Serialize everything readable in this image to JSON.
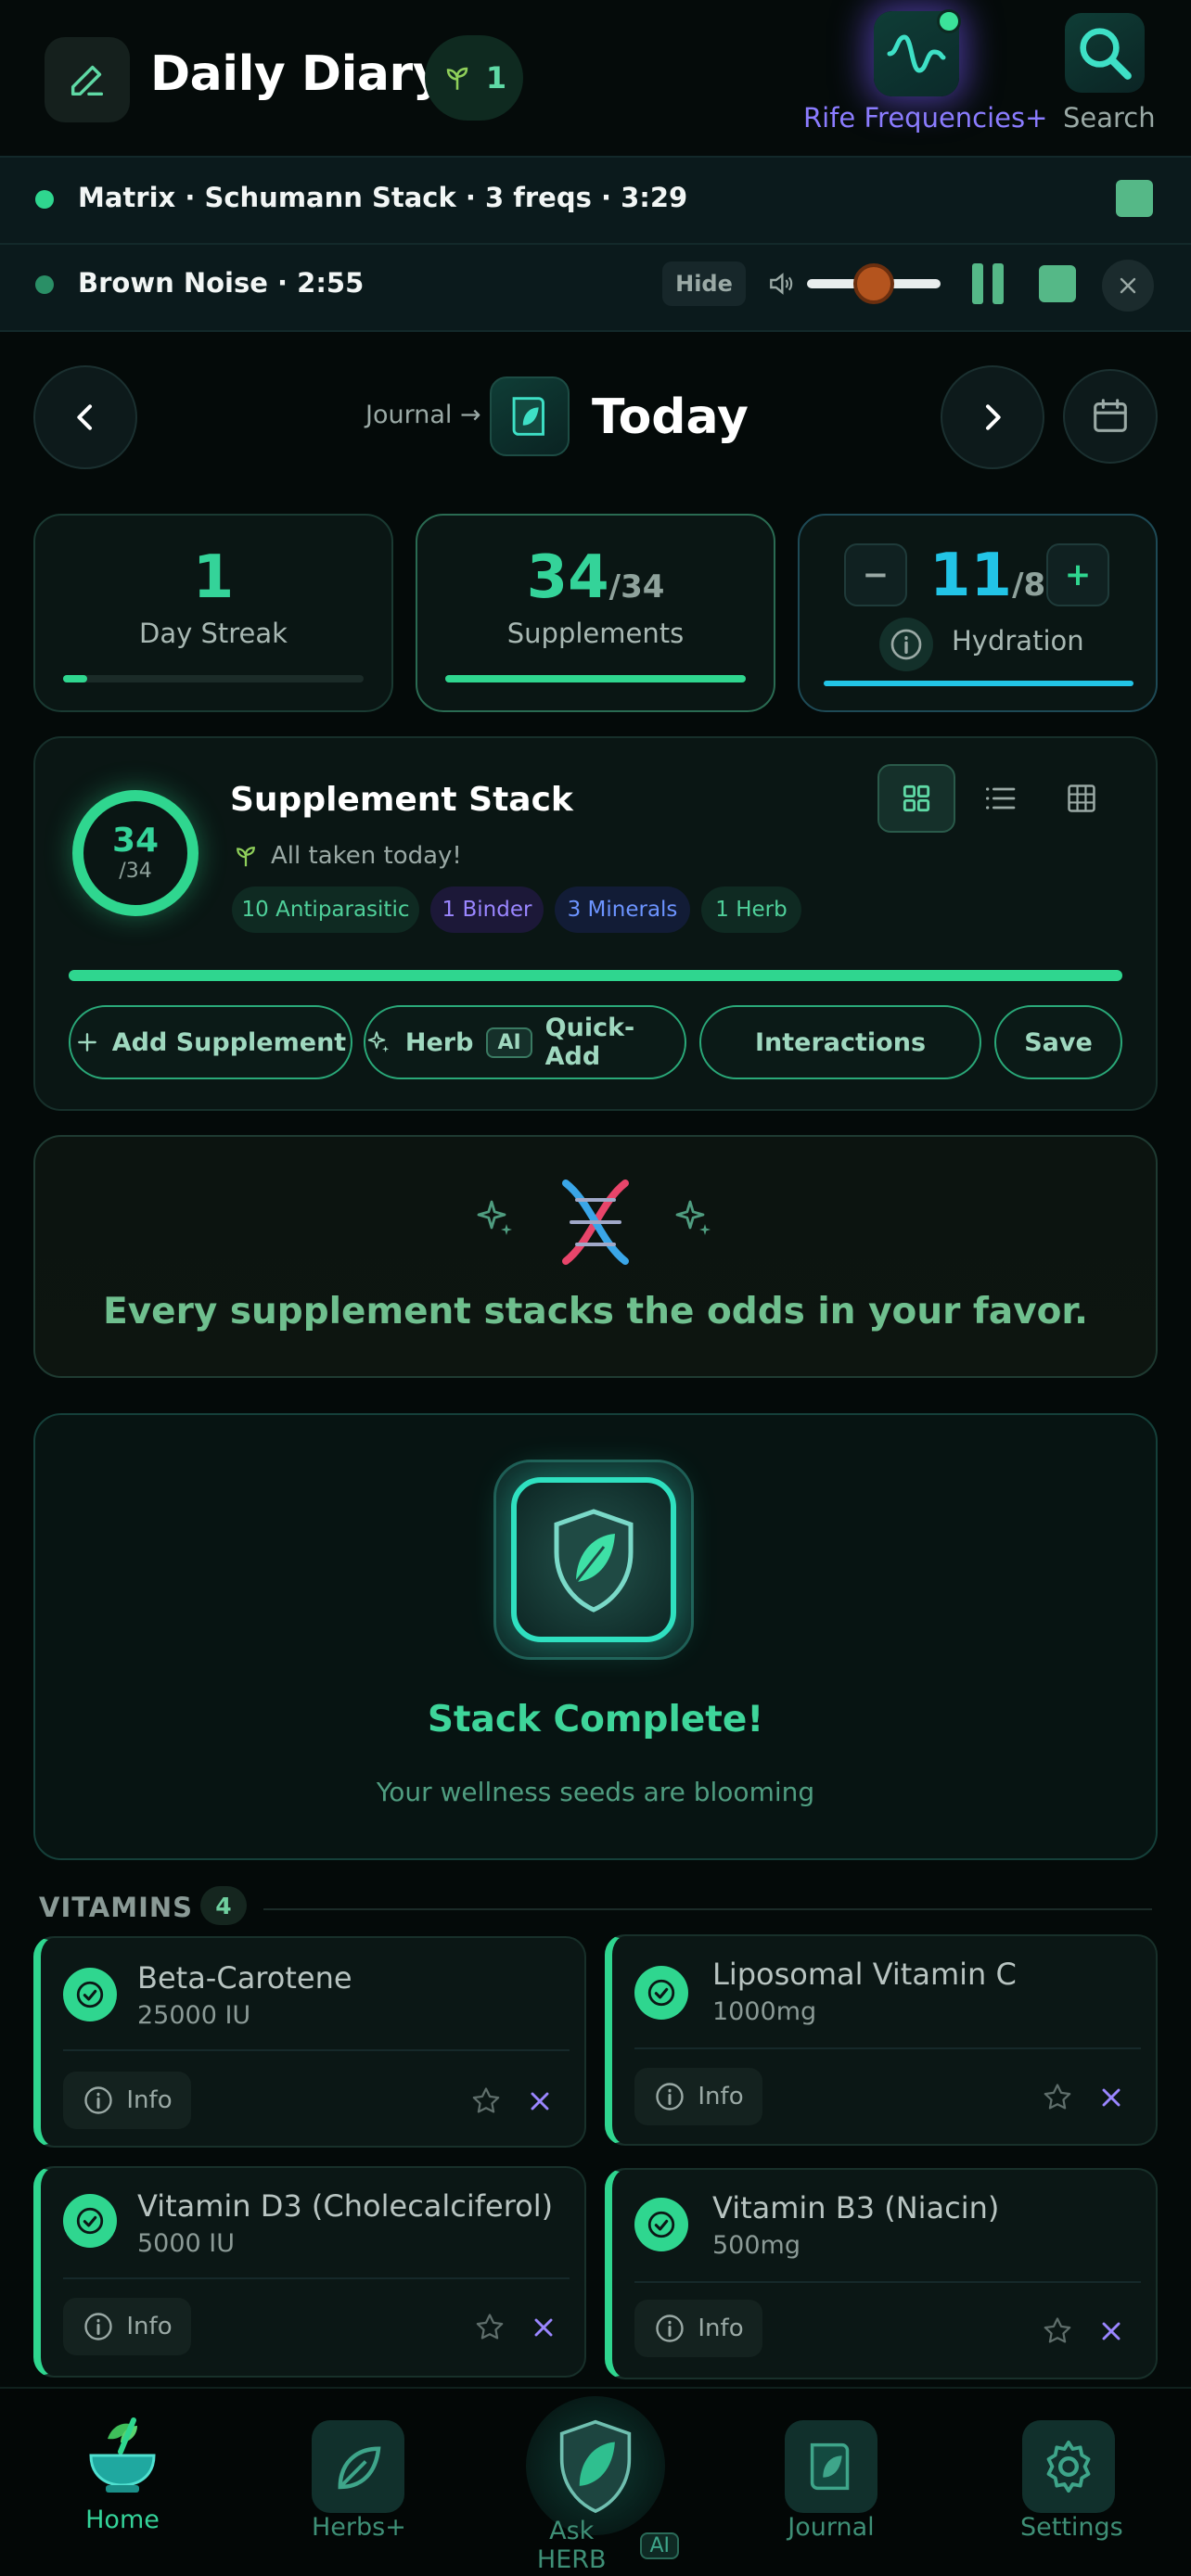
{
  "header": {
    "title": "Daily Diary",
    "streak_count": "1",
    "rife_label": "Rife Frequencies+",
    "search_label": "Search"
  },
  "audio": {
    "track1": "Matrix · Schumann Stack · 3 freqs · 3:29",
    "track2": "Brown Noise · 2:55",
    "hide_label": "Hide",
    "volume": 0.5
  },
  "nav": {
    "crumb": "Journal →",
    "title": "Today"
  },
  "stats": {
    "streak_value": "1",
    "streak_label": "Day Streak",
    "streak_progress": 0.08,
    "supp_value": "34",
    "supp_total": "/34",
    "supp_label": "Supplements",
    "supp_progress": 1.0,
    "hydration_value": "11",
    "hydration_total": "/8",
    "hydration_label": "Hydration",
    "hydration_progress": 1.0,
    "minus": "−",
    "plus": "+"
  },
  "stack": {
    "ring_value": "34",
    "ring_total": "/34",
    "title": "Supplement Stack",
    "subtitle": "All taken today!",
    "chips": [
      "10 Antiparasitic",
      "1 Binder",
      "3 Minerals",
      "1 Herb"
    ],
    "progress": 1.0,
    "actions": {
      "add": "Add Supplement",
      "herb": "Herb",
      "ai": "AI",
      "quick_add": "Quick-Add",
      "interactions": "Interactions",
      "save": "Save"
    }
  },
  "quote": {
    "text": "Every supplement stacks the odds in your favor."
  },
  "complete": {
    "title": "Stack Complete!",
    "subtitle": "Your wellness seeds are blooming"
  },
  "vitamins": {
    "section": "VITAMINS",
    "count": "4",
    "info_label": "Info",
    "items": [
      {
        "name": "Beta-Carotene",
        "dose": "25000 IU"
      },
      {
        "name": "Liposomal Vitamin C",
        "dose": "1000mg"
      },
      {
        "name": "Vitamin D3 (Cholecalciferol)",
        "dose": "5000 IU"
      },
      {
        "name": "Vitamin B3 (Niacin)",
        "dose": "500mg"
      }
    ]
  },
  "tabs": {
    "home": "Home",
    "herbs": "Herbs+",
    "ask": "Ask HERB",
    "ask_ai": "AI",
    "journal": "Journal",
    "settings": "Settings"
  },
  "colors": {
    "accent": "#34d399",
    "cyan": "#22c4e6",
    "purple": "#8b7cff"
  }
}
